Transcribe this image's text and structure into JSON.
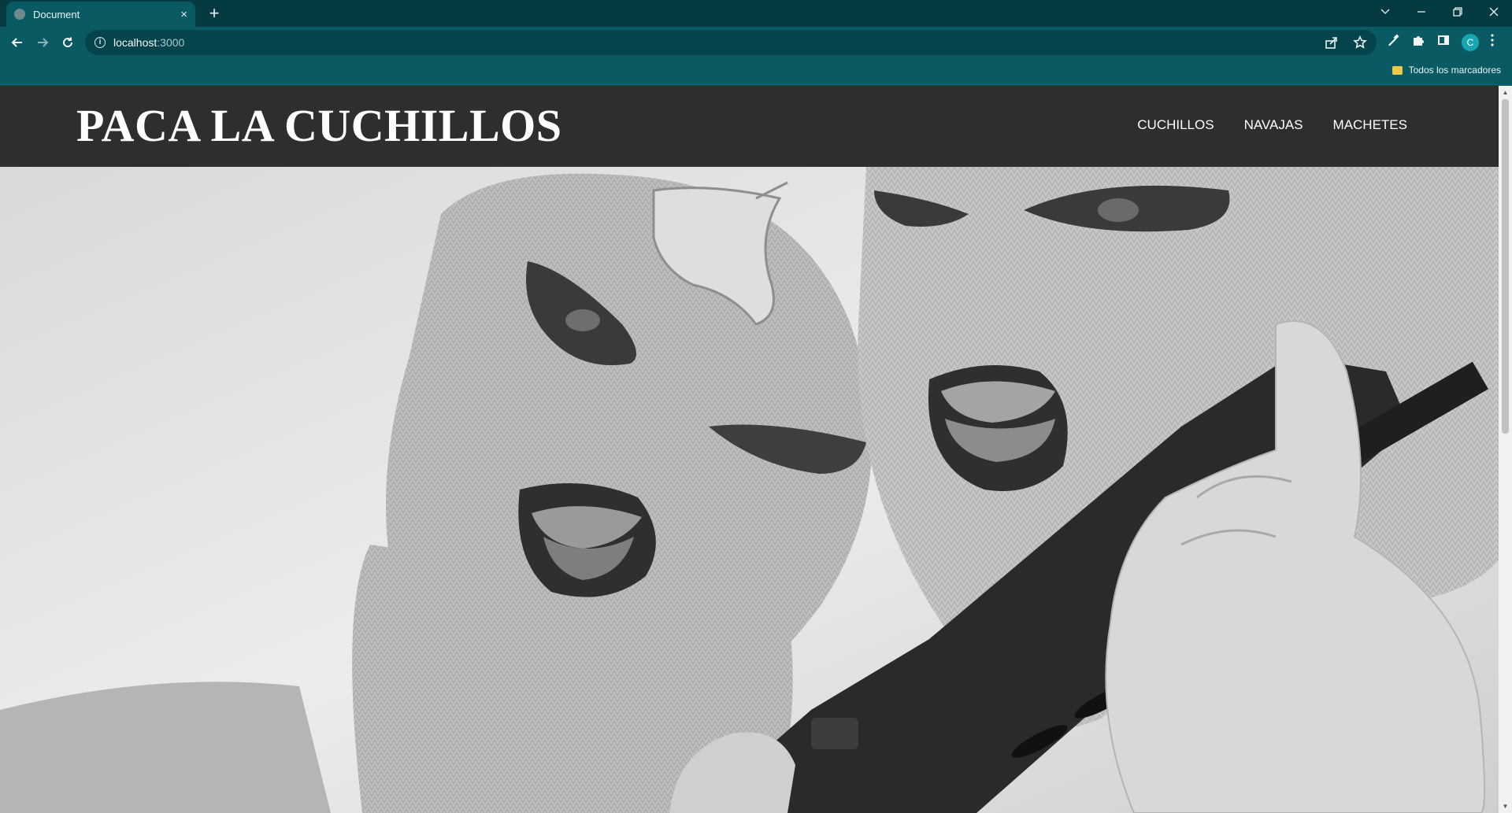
{
  "browser": {
    "tab_title": "Document",
    "tab_close": "×",
    "new_tab": "+",
    "url_host": "localhost",
    "url_port": ":3000",
    "bookmark_folder": "Todos los marcadores",
    "avatar_letter": "C"
  },
  "site": {
    "title": "PACA LA CUCHILLOS",
    "nav": [
      "CUCHILLOS",
      "NAVAJAS",
      "MACHETES"
    ]
  },
  "hero": {
    "description_icon": "hero-photo-masked-women"
  },
  "colors": {
    "chrome_dark": "#043a40",
    "chrome": "#0a5a63",
    "header_bg": "#2e2e2e"
  }
}
